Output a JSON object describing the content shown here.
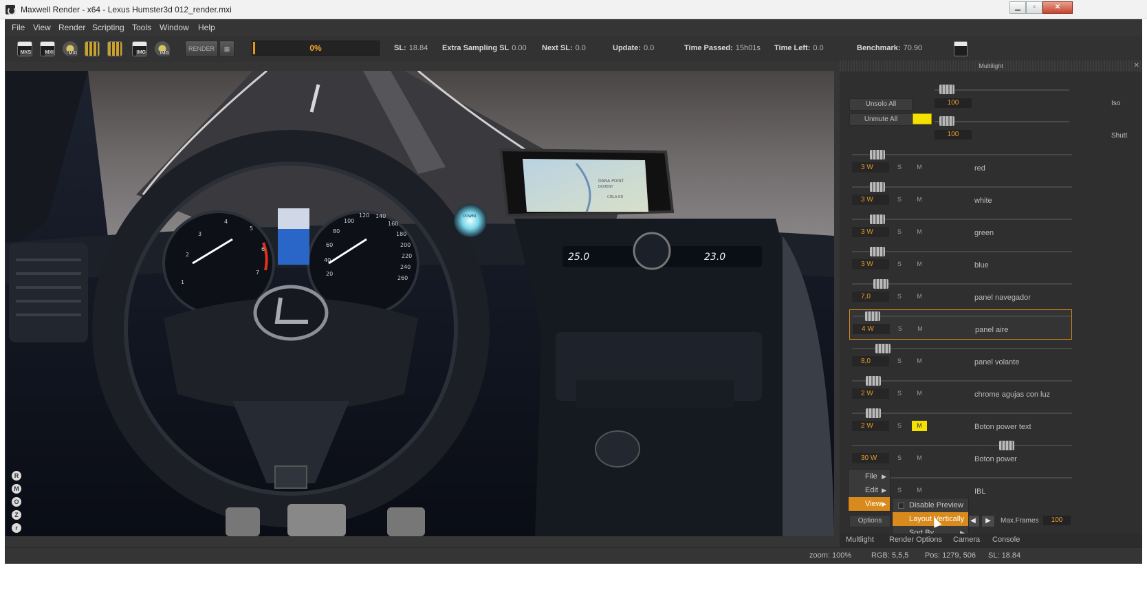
{
  "window": {
    "title": "Maxwell Render  -  x64 - Lexus Humster3d 012_render.mxi"
  },
  "menu": [
    "File",
    "View",
    "Render",
    "Scripting",
    "Tools",
    "Window",
    "Help"
  ],
  "toolbar": {
    "icons": [
      "MXS",
      "MXI",
      "MXI",
      "",
      "",
      "IMG",
      "IMG"
    ],
    "render_label": "RENDER",
    "progress_value": 0.0,
    "progress_text": "0%",
    "stats": [
      {
        "label": "SL:",
        "value": "18.84"
      },
      {
        "label": "Extra Sampling SL",
        "value": "0.00"
      },
      {
        "label": "Next SL:",
        "value": "0.0"
      },
      {
        "label": "Update:",
        "value": "0.0"
      },
      {
        "label": "Time Passed:",
        "value": "15h01s"
      },
      {
        "label": "Time Left:",
        "value": "0.0"
      },
      {
        "label": "Benchmark:",
        "value": "70.90"
      }
    ],
    "ms_label": "MS"
  },
  "viewport": {
    "side_tools": [
      "R",
      "M",
      "O",
      "Z",
      "r"
    ],
    "gauge_left_numbers": [
      "1",
      "2",
      "3",
      "4",
      "5",
      "6",
      "7"
    ],
    "gauge_right_numbers": [
      "20",
      "40",
      "60",
      "80",
      "100",
      "120",
      "140",
      "160",
      "180",
      "200",
      "220",
      "240",
      "260"
    ],
    "climate_left": "25.0",
    "climate_right": "23.0",
    "map_labels": [
      "DANA POINT",
      "DOHENY",
      "CIELA RD"
    ],
    "power_label": "POWER"
  },
  "multilight": {
    "title": "Multilight",
    "unsolo_all": "Unsolo All",
    "unmute_all": "Unmute All",
    "iso_value": "100",
    "iso_label": "Iso",
    "shutter_value": "100",
    "shutter_label": "Shutt",
    "unmute_color": "#f5e100",
    "lights": [
      {
        "value": "3  W",
        "name": "red",
        "muted": false,
        "selected": false
      },
      {
        "value": "3  W",
        "name": "white",
        "muted": false,
        "selected": false
      },
      {
        "value": "3  W",
        "name": "green",
        "muted": false,
        "selected": false
      },
      {
        "value": "3  W",
        "name": "blue",
        "muted": false,
        "selected": false
      },
      {
        "value": "7,0",
        "name": "panel navegador",
        "muted": false,
        "selected": false
      },
      {
        "value": "4  W",
        "name": "panel aire",
        "muted": false,
        "selected": true
      },
      {
        "value": "8,0",
        "name": "panel volante",
        "muted": false,
        "selected": false
      },
      {
        "value": "2  W",
        "name": "chrome agujas con luz",
        "muted": false,
        "selected": false
      },
      {
        "value": "2  W",
        "name": "Boton power text",
        "muted": true,
        "selected": false
      },
      {
        "value": "30  W",
        "name": "Boton power",
        "muted": false,
        "selected": false
      },
      {
        "value": "",
        "name": "IBL",
        "muted": false,
        "selected": false
      }
    ],
    "s_label": "S",
    "m_label": "M",
    "options_label": "Options",
    "max_frames_label": "Max.Frames",
    "max_frames_value": "100"
  },
  "context_menu": {
    "main": [
      "File",
      "Edit",
      "View"
    ],
    "sub": [
      "Disable Preview",
      "Layout Vertically",
      "Sort By"
    ]
  },
  "panel_tabs": [
    "Multlight",
    "Render Options",
    "Camera",
    "Console"
  ],
  "status": {
    "zoom": "zoom: 100%",
    "rgb": "RGB: 5,5,5",
    "pos": "Pos: 1279, 506",
    "sl": "SL: 18.84"
  }
}
